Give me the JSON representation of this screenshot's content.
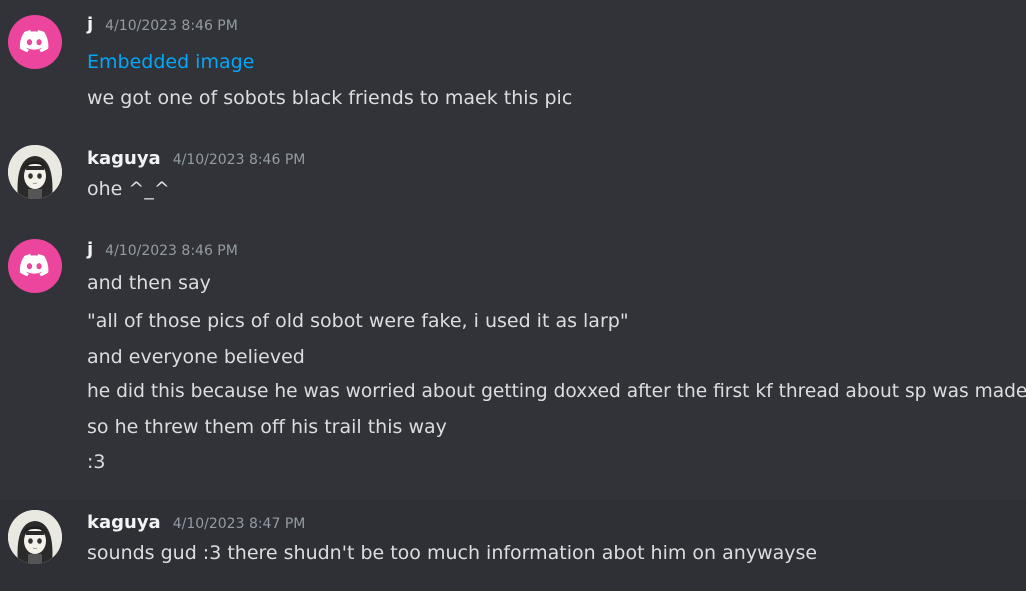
{
  "messages": [
    {
      "author": "j",
      "timestamp": "4/10/2023 8:46 PM",
      "avatar_icon": "discord-logo-icon",
      "lines": [
        {
          "text": "Embedded image",
          "is_link": true
        },
        {
          "text": "we got one of sobots black friends to maek this pic",
          "is_link": false
        }
      ]
    },
    {
      "author": "kaguya",
      "timestamp": "4/10/2023 8:46 PM",
      "avatar_icon": "anime-girl-avatar",
      "lines": [
        {
          "text": "ohe ^_^",
          "is_link": false
        }
      ]
    },
    {
      "author": "j",
      "timestamp": "4/10/2023 8:46 PM",
      "avatar_icon": "discord-logo-icon",
      "lines": [
        {
          "text": "and then say",
          "is_link": false
        },
        {
          "text": "\"all of those pics of old sobot were fake, i used it as larp\"",
          "is_link": false
        },
        {
          "text": "and everyone believed",
          "is_link": false
        },
        {
          "text": "he did this because he was worried about getting doxxed after the first kf thread about sp was made",
          "is_link": false
        },
        {
          "text": "so he threw them off his trail this way",
          "is_link": false
        },
        {
          "text": ":3",
          "is_link": false
        }
      ]
    },
    {
      "author": "kaguya",
      "timestamp": "4/10/2023 8:47 PM",
      "avatar_icon": "anime-girl-avatar",
      "lines": [
        {
          "text": "sounds gud :3 there shudn't be too much information abot him on anywayse",
          "is_link": false
        }
      ]
    }
  ]
}
